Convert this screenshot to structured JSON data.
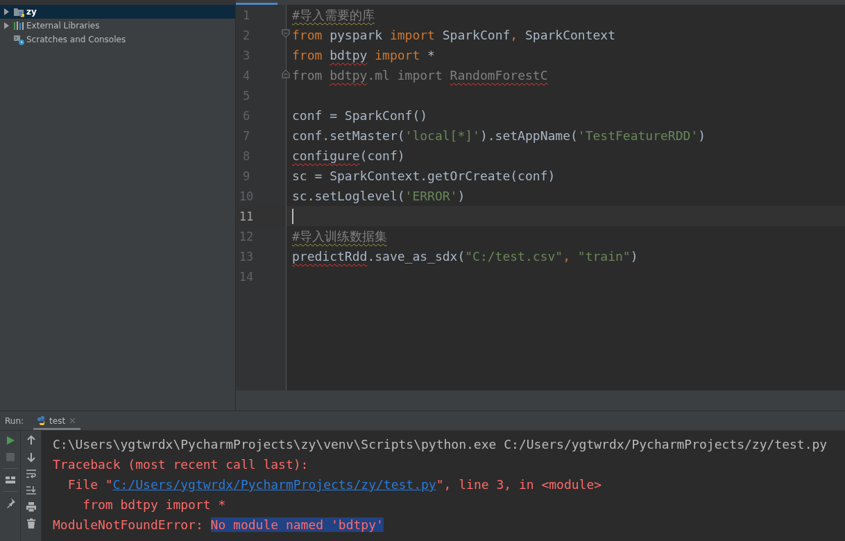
{
  "project_tree": {
    "items": [
      {
        "label": "zy",
        "expanded": false,
        "selected": true
      },
      {
        "label": "External Libraries",
        "expanded": false,
        "selected": false
      },
      {
        "label": "Scratches and Consoles",
        "selected": false
      }
    ]
  },
  "editor": {
    "lines": [
      {
        "number": "1",
        "current": false,
        "tokens": [
          {
            "text": "#导入需要的库",
            "kind": "comment",
            "misspelled": true
          }
        ]
      },
      {
        "number": "2",
        "current": false,
        "fold_start": true,
        "tokens": [
          {
            "text": "from",
            "kind": "keyword"
          },
          {
            "text": " pyspark ",
            "kind": "ident"
          },
          {
            "text": "import",
            "kind": "keyword"
          },
          {
            "text": " SparkConf",
            "kind": "ident"
          },
          {
            "text": ",",
            "kind": "keyword"
          },
          {
            "text": " SparkContext",
            "kind": "ident"
          }
        ]
      },
      {
        "number": "3",
        "current": false,
        "tokens": [
          {
            "text": "from ",
            "kind": "keyword"
          },
          {
            "text": "bdtpy",
            "kind": "ident",
            "unresolved": true
          },
          {
            "text": " import",
            "kind": "keyword"
          },
          {
            "text": " *",
            "kind": "ident"
          }
        ]
      },
      {
        "number": "4",
        "current": false,
        "fold_end": true,
        "tokens": [
          {
            "text": "from ",
            "kind": "unused"
          },
          {
            "text": "bdtpy",
            "kind": "unused",
            "unresolved": true
          },
          {
            "text": ".ml import ",
            "kind": "unused"
          },
          {
            "text": "RandomForestC",
            "kind": "unused",
            "unresolved": true
          }
        ]
      },
      {
        "number": "5",
        "current": false
      },
      {
        "number": "6",
        "current": false,
        "tokens": [
          {
            "text": "conf = SparkConf()",
            "kind": "ident"
          }
        ]
      },
      {
        "number": "7",
        "current": false,
        "tokens": [
          {
            "text": "conf.setMaster(",
            "kind": "ident"
          },
          {
            "text": "'local[*]'",
            "kind": "string"
          },
          {
            "text": ").setAppName(",
            "kind": "ident"
          },
          {
            "text": "'TestFeatureRDD'",
            "kind": "string"
          },
          {
            "text": ")",
            "kind": "ident"
          }
        ]
      },
      {
        "number": "8",
        "current": false,
        "tokens": [
          {
            "text": "configure",
            "kind": "ident",
            "unresolved": true
          },
          {
            "text": "(conf)",
            "kind": "ident"
          }
        ]
      },
      {
        "number": "9",
        "current": false,
        "tokens": [
          {
            "text": "sc = SparkContext.getOrCreate(conf)",
            "kind": "ident"
          }
        ]
      },
      {
        "number": "10",
        "current": false,
        "tokens": [
          {
            "text": "sc.setLoglevel(",
            "kind": "ident"
          },
          {
            "text": "'ERROR'",
            "kind": "string"
          },
          {
            "text": ")",
            "kind": "ident"
          }
        ]
      },
      {
        "number": "11",
        "current": true
      },
      {
        "number": "12",
        "current": false,
        "tokens": [
          {
            "text": "#导入训练数据集",
            "kind": "comment",
            "misspelled": true
          }
        ]
      },
      {
        "number": "13",
        "current": false,
        "tokens": [
          {
            "text": "predictRdd",
            "kind": "ident",
            "unresolved": true
          },
          {
            "text": ".save_as_sdx(",
            "kind": "ident"
          },
          {
            "text": "\"C:/test.csv\"",
            "kind": "string"
          },
          {
            "text": ", ",
            "kind": "keyword"
          },
          {
            "text": "\"train\"",
            "kind": "string"
          },
          {
            "text": ")",
            "kind": "ident"
          }
        ]
      },
      {
        "number": "14",
        "current": false
      }
    ]
  },
  "run_panel": {
    "label": "Run:",
    "tabs": [
      {
        "label": "test",
        "selected": true
      }
    ],
    "console": [
      {
        "segments": [
          {
            "text": "C:\\Users\\ygtwrdx\\PycharmProjects\\zy\\venv\\Scripts\\python.exe C:/Users/ygtwrdx/PycharmProjects/zy/test.py",
            "kind": "command"
          }
        ]
      },
      {
        "segments": [
          {
            "text": "Traceback (most recent call last):",
            "kind": "error"
          }
        ]
      },
      {
        "segments": [
          {
            "text": "  File \"",
            "kind": "error"
          },
          {
            "text": "C:/Users/ygtwrdx/PycharmProjects/zy/test.py",
            "kind": "link"
          },
          {
            "text": "\", line 3, in <module>",
            "kind": "error"
          }
        ]
      },
      {
        "segments": [
          {
            "text": "    from bdtpy import *",
            "kind": "error"
          }
        ]
      },
      {
        "segments": [
          {
            "text": "ModuleNotFoundError: ",
            "kind": "error"
          },
          {
            "text": "No module named 'bdtpy'",
            "kind": "selected"
          }
        ]
      }
    ]
  }
}
